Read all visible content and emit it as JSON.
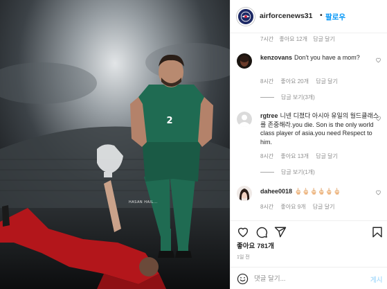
{
  "post": {
    "author": "airforcenews31",
    "separator": "•",
    "follow_label": "팔로우",
    "photo_credit": "HASAN HAIL..."
  },
  "top_comment_meta": {
    "time": "7시간",
    "likes": "좋아요 12개",
    "reply": "답글 달기"
  },
  "comments": [
    {
      "username": "kenzovans",
      "text": "Don't you have a mom?",
      "time": "8시간",
      "likes": "좋아요 20개",
      "reply": "답글 달기",
      "view_replies": "답글 보기(3개)"
    },
    {
      "username": "rgtree",
      "text": "니넨 디졌다 아시아 유일의 월드클래스 를 존중해라.you die. Son is the only world class player of asia.you need Respect to him.",
      "time": "8시간",
      "likes": "좋아요 13개",
      "reply": "답글 달기",
      "view_replies": "답글 보기(1개)"
    },
    {
      "username": "dahee0018",
      "text": "🖕🏻🖕🏻🖕🏻🖕🏻🖕🏻🖕🏻",
      "time": "8시간",
      "likes": "좋아요 9개",
      "reply": "답글 달기"
    }
  ],
  "actions": {
    "like_icon": "heart-icon",
    "comment_icon": "comment-icon",
    "share_icon": "share-icon",
    "save_icon": "bookmark-icon"
  },
  "likes": {
    "label": "좋아요",
    "count": "781개"
  },
  "post_time": "1일 전",
  "add_comment": {
    "placeholder": "댓글 달기...",
    "post_label": "게시"
  },
  "colors": {
    "accent": "#0095f6",
    "meta": "#8e8e8e",
    "post_disabled": "#b2dffc",
    "jersey_green": "#1f6b52",
    "jersey_red": "#b3161b"
  }
}
